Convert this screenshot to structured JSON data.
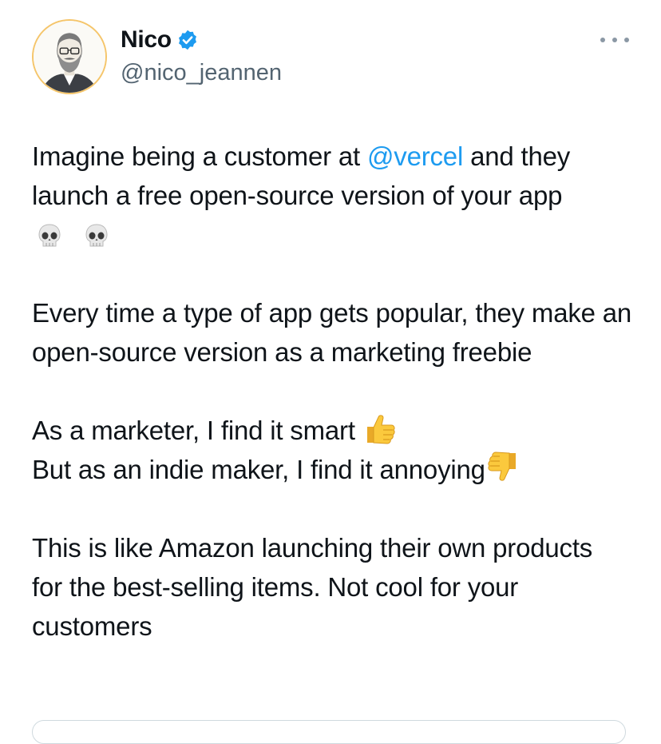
{
  "author": {
    "name": "Nico",
    "handle": "@nico_jeannen",
    "verified": true,
    "verified_color": "#1d9bf0",
    "avatar_icon": "bearded-man-with-glasses-illustration"
  },
  "more_icon": "ellipsis-icon",
  "tweet": {
    "p1_before": "Imagine being a customer at ",
    "p1_mention": "@vercel",
    "p1_after": " and they launch a free open-source version of your app",
    "p1_emoji": "skull-emoji",
    "p2": "Every time a type of app gets popular, they make an open-source version as a marketing freebie",
    "p3_line1": "As a marketer, I find it smart",
    "p3_line1_emoji": "thumbs-up-emoji",
    "p3_line2": "But as an indie maker, I find it annoying",
    "p3_line2_emoji": "thumbs-down-emoji",
    "p4": "This is like Amazon launching their own products for the best-selling items. Not cool for your customers"
  },
  "colors": {
    "text": "#0f1419",
    "secondary": "#536471",
    "mention": "#1d9bf0"
  }
}
